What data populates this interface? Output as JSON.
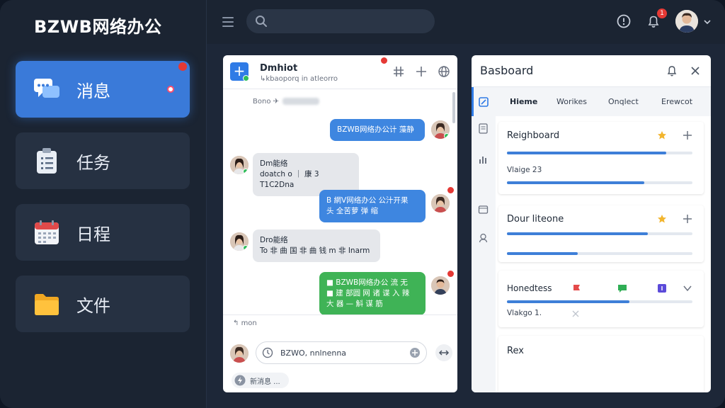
{
  "app": {
    "title": "BZWB网络办公"
  },
  "sidebar": {
    "items": [
      {
        "label": "消息",
        "icon": "chat-bubbles-icon",
        "active": true
      },
      {
        "label": "任务",
        "icon": "clipboard-icon",
        "active": false
      },
      {
        "label": "日程",
        "icon": "calendar-icon",
        "active": false
      },
      {
        "label": "文件",
        "icon": "folder-icon",
        "active": false
      }
    ]
  },
  "topbar": {
    "search_placeholder": "",
    "notification_count": "1"
  },
  "chat": {
    "name": "Dmhiot",
    "subtitle": "↳kbaoporq in atleorro",
    "hint": "Bono  ✈",
    "messages": [
      {
        "side": "right",
        "style": "blue",
        "text": "BZWB网络办公计 藻静"
      },
      {
        "side": "left",
        "style": "gray",
        "title": "Dm能络",
        "text": "doatch o ｜ 康 3 T1C2Dna"
      },
      {
        "side": "right",
        "style": "blue",
        "text": "B 網V网络办公 公汁开果\n头 全苦萝 弹 缩"
      },
      {
        "side": "left",
        "style": "gray",
        "title": "Dro能络",
        "text": "To 非 曲 国 非 曲 钱 m 非 Inarm"
      },
      {
        "side": "right",
        "style": "green",
        "text": "■ BZWB网络办公 流 无\n■ 建 部圆 网 诸 谍 入 辣\n大 器 — 斛 谋 筋"
      }
    ],
    "footer_hint": "mon",
    "input_value": "BZWO, nnlnenna",
    "status": "新消息 ..."
  },
  "dashboard": {
    "title": "Basboard",
    "tabs": [
      "Hieme",
      "Worikes",
      "Onqlect",
      "Erewcot"
    ],
    "cards": [
      {
        "title": "Reighboard",
        "sub": "Vlaige 23",
        "progress": [
          0.86,
          0.74
        ]
      },
      {
        "title": "Dour liteone",
        "sub": "",
        "progress": [
          0.76,
          0.38
        ]
      },
      {
        "title": "Honedtess",
        "sub": "Vlakgo 1.",
        "progress": [
          0.66
        ]
      },
      {
        "title": "Rex",
        "sub": "",
        "progress": []
      }
    ]
  },
  "colors": {
    "accent": "#3a7ad9",
    "sidebar_bg": "#1b2432",
    "badge": "#e53935",
    "green_bubble": "#3fb356",
    "blue_bubble": "#3e86e0"
  }
}
